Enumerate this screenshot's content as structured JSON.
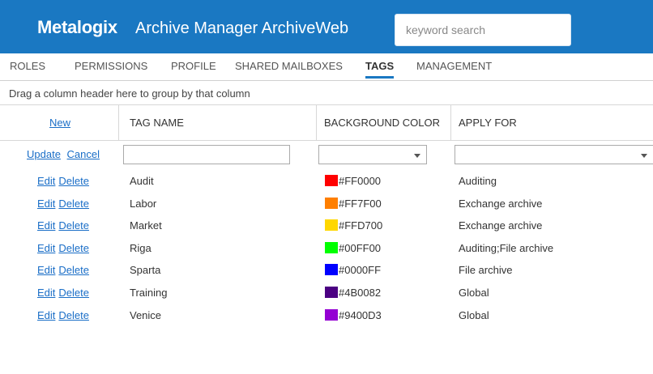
{
  "header": {
    "logo": "Metalogix",
    "app_title": "Archive Manager ArchiveWeb",
    "search_placeholder": "keyword search",
    "background": "#1a78c2"
  },
  "nav": {
    "items": [
      {
        "label": "ROLES"
      },
      {
        "label": "PERMISSIONS"
      },
      {
        "label": "PROFILE"
      },
      {
        "label": "SHARED MAILBOXES"
      },
      {
        "label": "TAGS",
        "active": true
      },
      {
        "label": "MANAGEMENT"
      }
    ]
  },
  "grid": {
    "group_hint": "Drag a column header here to group by that column",
    "new_label": "New",
    "columns": {
      "tag_name": "TAG NAME",
      "background_color": "BACKGROUND COLOR",
      "apply_for": "APPLY FOR"
    },
    "edit_row": {
      "update_label": "Update",
      "cancel_label": "Cancel",
      "tag_name_value": "",
      "background_color_value": "",
      "apply_for_value": ""
    },
    "row_actions": {
      "edit": "Edit",
      "delete": "Delete"
    },
    "rows": [
      {
        "name": "Audit",
        "color": "#FF0000",
        "apply_for": "Auditing"
      },
      {
        "name": "Labor",
        "color": "#FF7F00",
        "apply_for": "Exchange archive"
      },
      {
        "name": "Market",
        "color": "#FFD700",
        "apply_for": "Exchange archive"
      },
      {
        "name": "Riga",
        "color": "#00FF00",
        "apply_for": "Auditing;File archive"
      },
      {
        "name": "Sparta",
        "color": "#0000FF",
        "apply_for": "File archive"
      },
      {
        "name": "Training",
        "color": "#4B0082",
        "apply_for": "Global"
      },
      {
        "name": "Venice",
        "color": "#9400D3",
        "apply_for": "Global"
      }
    ]
  }
}
